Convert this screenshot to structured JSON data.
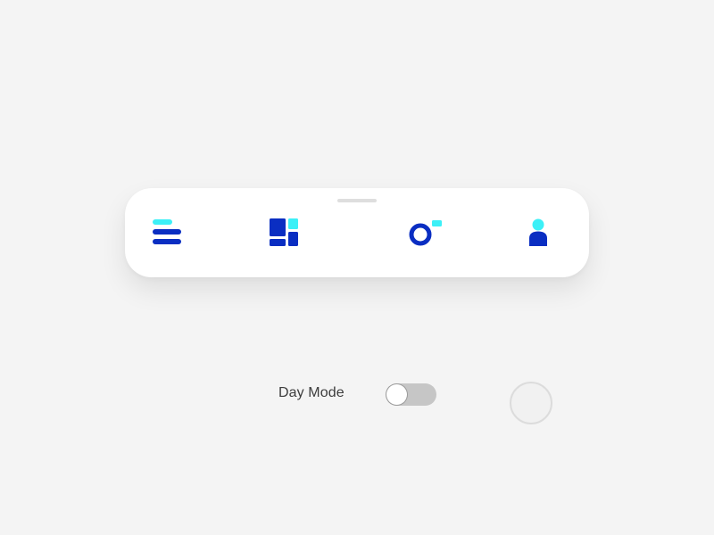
{
  "colors": {
    "background": "#f4f4f4",
    "bar_background": "#ffffff",
    "primary_blue": "#0a2ec2",
    "accent_cyan": "#3cf0f7",
    "switch_track": "#c6c6c6",
    "label_text": "#3c3c3c"
  },
  "tab_bar": {
    "tabs": [
      {
        "icon": "menu-icon"
      },
      {
        "icon": "dashboard-icon"
      },
      {
        "icon": "toggle-ring-icon"
      },
      {
        "icon": "user-icon"
      }
    ]
  },
  "controls": {
    "mode_label": "Day Mode",
    "mode_switch_on": false
  }
}
